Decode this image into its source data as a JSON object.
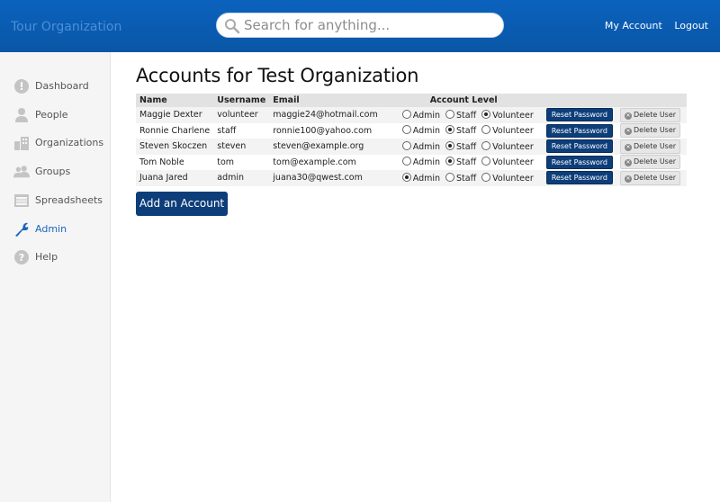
{
  "header": {
    "brand": "Tour Organization",
    "search_placeholder": "Search for anything...",
    "my_account": "My Account",
    "logout": "Logout"
  },
  "sidebar": {
    "items": [
      {
        "label": "Dashboard",
        "icon": "dashboard-icon"
      },
      {
        "label": "People",
        "icon": "person-icon"
      },
      {
        "label": "Organizations",
        "icon": "buildings-icon"
      },
      {
        "label": "Groups",
        "icon": "group-icon"
      },
      {
        "label": "Spreadsheets",
        "icon": "spreadsheet-icon"
      },
      {
        "label": "Admin",
        "icon": "wrench-icon",
        "active": true
      },
      {
        "label": "Help",
        "icon": "help-icon"
      }
    ]
  },
  "main": {
    "title": "Accounts for Test Organization",
    "columns": {
      "name": "Name",
      "username": "Username",
      "email": "Email",
      "level": "Account Level"
    },
    "level_options": {
      "admin": "Admin",
      "staff": "Staff",
      "volunteer": "Volunteer"
    },
    "reset_label": "Reset Password",
    "delete_label": "Delete User",
    "rows": [
      {
        "name": "Maggie Dexter",
        "username": "volunteer",
        "email": "maggie24@hotmail.com",
        "level": "volunteer"
      },
      {
        "name": "Ronnie Charlene",
        "username": "staff",
        "email": "ronnie100@yahoo.com",
        "level": "staff"
      },
      {
        "name": "Steven Skoczen",
        "username": "steven",
        "email": "steven@example.org",
        "level": "staff"
      },
      {
        "name": "Tom Noble",
        "username": "tom",
        "email": "tom@example.com",
        "level": "staff"
      },
      {
        "name": "Juana Jared",
        "username": "admin",
        "email": "juana30@qwest.com",
        "level": "admin"
      }
    ],
    "add_label": "Add an Account"
  },
  "colors": {
    "header_bg": "#0a5bb0",
    "button_dark": "#0d3e7a",
    "active_nav": "#1a66c0"
  }
}
